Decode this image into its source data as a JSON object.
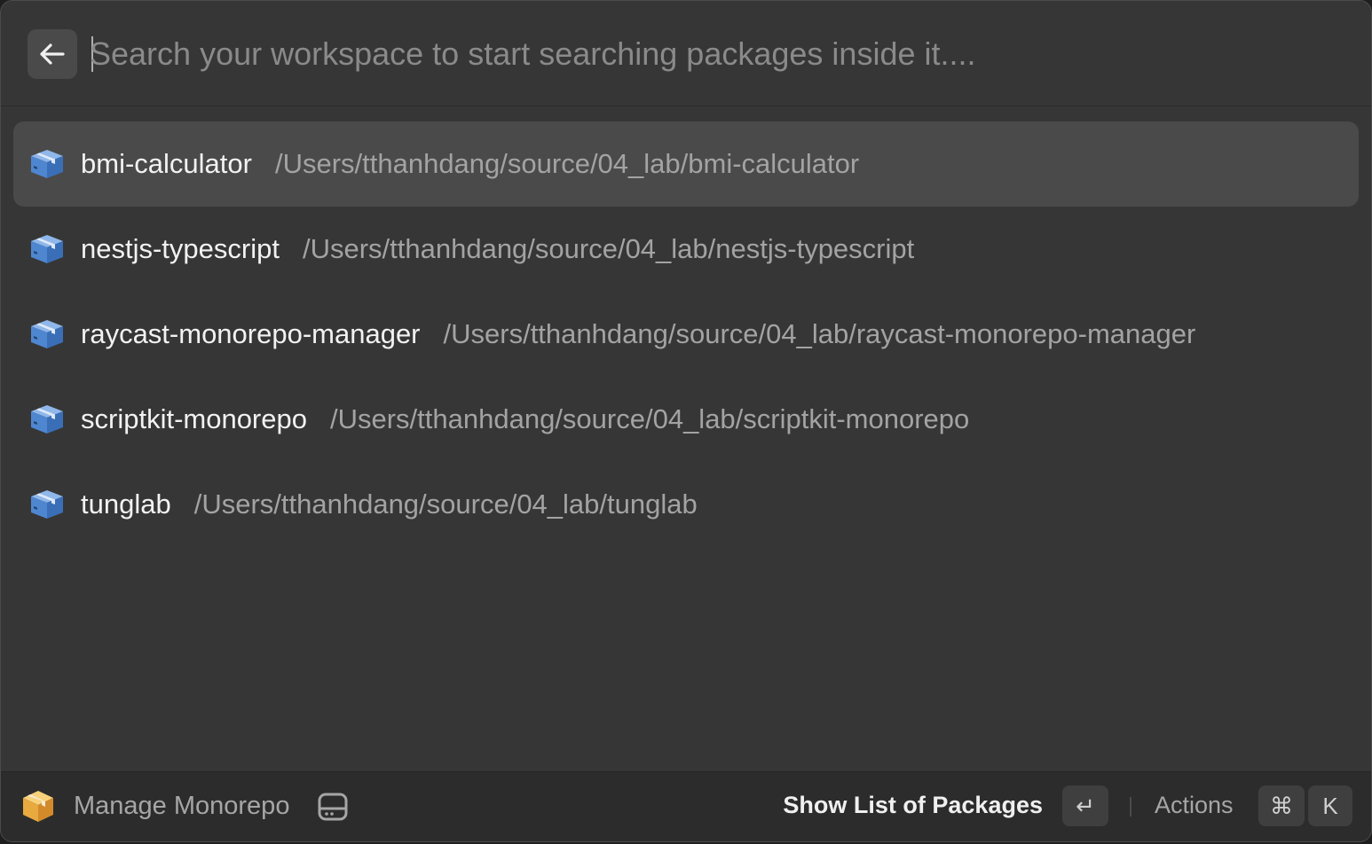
{
  "search": {
    "placeholder": "Search your workspace to start searching packages inside it....",
    "value": ""
  },
  "back_icon": "arrow-left-icon",
  "packages": [
    {
      "name": "bmi-calculator",
      "path": "/Users/tthanhdang/source/04_lab/bmi-calculator",
      "icon": "package-box-icon",
      "selected": true
    },
    {
      "name": "nestjs-typescript",
      "path": "/Users/tthanhdang/source/04_lab/nestjs-typescript",
      "icon": "package-box-icon",
      "selected": false
    },
    {
      "name": "raycast-monorepo-manager",
      "path": "/Users/tthanhdang/source/04_lab/raycast-monorepo-manager",
      "icon": "package-box-icon",
      "selected": false
    },
    {
      "name": "scriptkit-monorepo",
      "path": "/Users/tthanhdang/source/04_lab/scriptkit-monorepo",
      "icon": "package-box-icon",
      "selected": false
    },
    {
      "name": "tunglab",
      "path": "/Users/tthanhdang/source/04_lab/tunglab",
      "icon": "package-box-icon",
      "selected": false
    }
  ],
  "footer": {
    "app_name": "Manage Monorepo",
    "app_icon": "cardboard-box-icon",
    "mode_icon": "hard-drive-icon",
    "primary_action": "Show List of Packages",
    "enter_key": "↵",
    "actions_label": "Actions",
    "cmd_key": "⌘",
    "k_key": "K"
  },
  "colors": {
    "window_bg": "#363636",
    "selected_row_bg": "#4a4a4a",
    "footer_bg": "#2c2c2c",
    "title_text": "#f2f2f2",
    "subtitle_text": "#a3a3a3",
    "package_icon_blue": "#5b8fd6"
  }
}
